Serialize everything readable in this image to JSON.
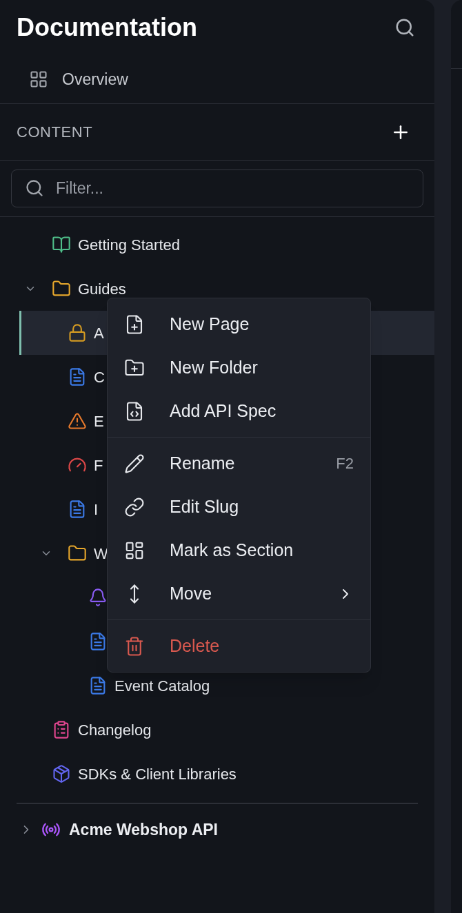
{
  "sidebar": {
    "title": "Documentation",
    "overview": {
      "label": "Overview"
    },
    "section": {
      "label": "CONTENT"
    },
    "filter": {
      "placeholder": "Filter..."
    },
    "tree": [
      {
        "label": "Getting Started",
        "kind": "book",
        "color": "#4fbf8a",
        "selected": false
      },
      {
        "label": "Guides",
        "kind": "folder",
        "color": "#e8a82c",
        "expanded": true,
        "selected": false,
        "children": [
          {
            "label": "A",
            "kind": "lock",
            "color": "#d39a22",
            "selected": true
          },
          {
            "label": "C",
            "kind": "doc",
            "color": "#3b7ae8",
            "selected": false
          },
          {
            "label": "E",
            "kind": "warning",
            "color": "#e87a2c",
            "selected": false
          },
          {
            "label": "F",
            "kind": "gauge",
            "color": "#e04848",
            "selected": false
          },
          {
            "label": "I",
            "kind": "doc",
            "color": "#3b7ae8",
            "selected": false
          },
          {
            "label": "W",
            "kind": "folder",
            "color": "#e8a82c",
            "expanded": true,
            "selected": false,
            "children": [
              {
                "kind": "bell",
                "color": "#8b5cf6",
                "selected": false
              },
              {
                "kind": "doc",
                "color": "#3b7ae8",
                "selected": false
              },
              {
                "label": "Event Catalog",
                "kind": "doc",
                "color": "#3b7ae8",
                "selected": false
              }
            ]
          }
        ]
      },
      {
        "label": "Changelog",
        "kind": "clipboard",
        "color": "#e0468f",
        "selected": false
      },
      {
        "label": "SDKs & Client Libraries",
        "kind": "package",
        "color": "#6366f1",
        "selected": false
      }
    ],
    "apis": [
      {
        "label": "Acme Webshop API",
        "kind": "broadcast",
        "color": "#a855f7",
        "expanded": false
      }
    ]
  },
  "context_menu": {
    "groups": [
      [
        {
          "label": "New Page",
          "kind": "file-plus"
        },
        {
          "label": "New Folder",
          "kind": "folder-plus"
        },
        {
          "label": "Add API Spec",
          "kind": "file-code"
        }
      ],
      [
        {
          "label": "Rename",
          "kind": "pencil",
          "shortcut": "F2"
        },
        {
          "label": "Edit Slug",
          "kind": "link"
        },
        {
          "label": "Mark as Section",
          "kind": "layout"
        },
        {
          "label": "Move",
          "kind": "move",
          "submenu": true
        }
      ],
      [
        {
          "label": "Delete",
          "kind": "trash",
          "danger": true
        }
      ]
    ]
  }
}
